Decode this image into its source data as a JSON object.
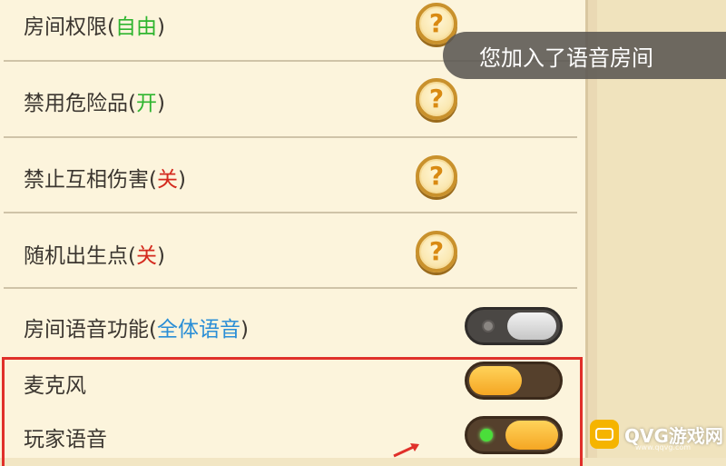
{
  "settings": [
    {
      "name": "房间权限",
      "value": "自由",
      "value_color": "#2fb52f",
      "control": "help-icon"
    },
    {
      "name": "禁用危险品",
      "value": "开",
      "value_color": "#2fb52f",
      "control": "help-icon"
    },
    {
      "name": "禁止互相伤害",
      "value": "关",
      "value_color": "#d42a1e",
      "control": "help-icon"
    },
    {
      "name": "随机出生点",
      "value": "关",
      "value_color": "#d42a1e",
      "control": "help-icon"
    },
    {
      "name": "房间语音功能",
      "value": "全体语音",
      "value_color": "#2a8ed6",
      "control": "toggle",
      "toggle_on": false
    },
    {
      "name": "麦克风",
      "control": "toggle",
      "toggle_on": true
    },
    {
      "name": "玩家语音",
      "control": "toggle",
      "toggle_on": true
    }
  ],
  "help_glyph": "?",
  "toast": {
    "text": "您加入了语音房间"
  },
  "watermark": {
    "text": "QVG游戏网",
    "sub": "www.qqvg.com"
  },
  "colors": {
    "panel_bg": "#fcf4dc",
    "highlight": "#e0302a",
    "toggle_on": "#f5a623"
  }
}
